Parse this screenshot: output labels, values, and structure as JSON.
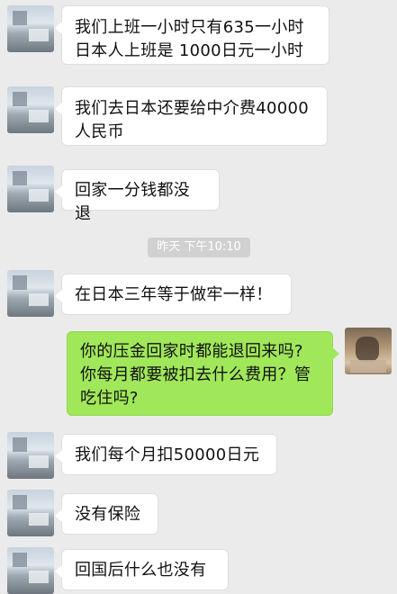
{
  "messages": [
    {
      "side": "in",
      "text": "我们上班一小时只有635一小时\n日本人上班是 1000日元一小时"
    },
    {
      "side": "in",
      "text": "我们去日本还要给中介费40000\n人民币"
    },
    {
      "side": "in",
      "text": "回家一分钱都没退"
    },
    {
      "side": "in",
      "text": "在日本三年等于做牢一样！"
    },
    {
      "side": "out",
      "text": "你的压金回家时都能退回来吗?\n你每月都要被扣去什么费用？管\n吃住吗?"
    },
    {
      "side": "in",
      "text": "我们每个月扣50000日元"
    },
    {
      "side": "in",
      "text": "没有保险"
    },
    {
      "side": "in",
      "text": "回国后什么也没有"
    }
  ],
  "timestamp": "昨天 下午10:10",
  "colors": {
    "background": "#ebebeb",
    "incoming_bubble": "#ffffff",
    "outgoing_bubble": "#a0e75a"
  }
}
